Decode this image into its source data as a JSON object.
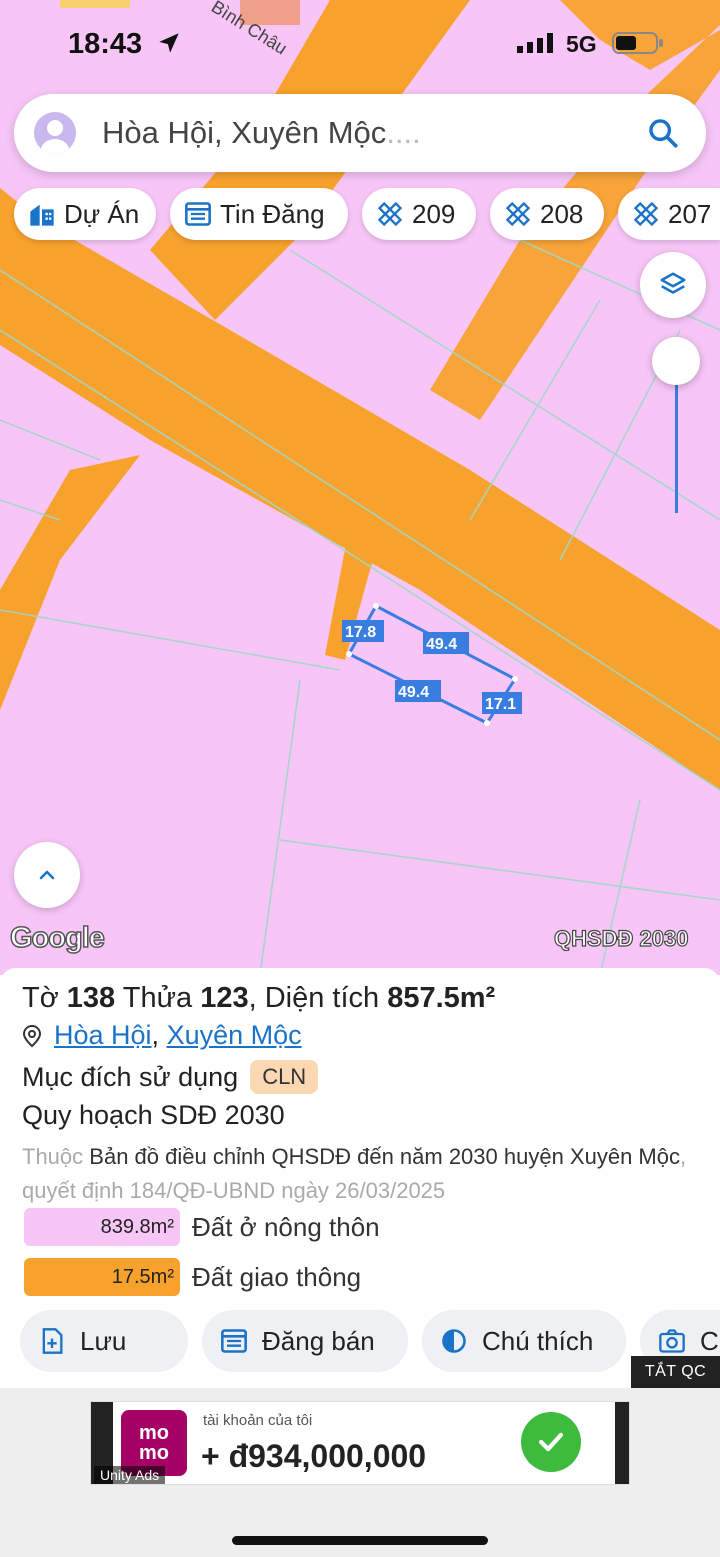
{
  "status_bar": {
    "time": "18:43",
    "network": "5G"
  },
  "map": {
    "street_label": "Bình Châu",
    "layer_label": "QHSDĐ 2030",
    "google_label": "Google",
    "edge_labels": [
      "17.8",
      "49.4",
      "49.4",
      "17.1"
    ]
  },
  "search": {
    "value": "Hòa Hội, Xuyên Mộc",
    "suffix": "...."
  },
  "chips": [
    {
      "label": "Dự Án",
      "icon": "building-icon"
    },
    {
      "label": "Tin Đăng",
      "icon": "listing-icon"
    },
    {
      "label": "209",
      "icon": "ruler-icon"
    },
    {
      "label": "208",
      "icon": "ruler-icon"
    },
    {
      "label": "207",
      "icon": "ruler-icon"
    }
  ],
  "parcel": {
    "sheet_label": "Tờ",
    "sheet": "138",
    "plot_label": "Thửa",
    "plot": "123",
    "area_label": ", Diện tích",
    "area": "857.5m²",
    "ward": "Hòa Hội",
    "district": "Xuyên Mộc",
    "purpose_label": "Mục đích sử dụng",
    "purpose_code": "CLN",
    "plan_title": "Quy hoạch SDĐ 2030",
    "desc_prefix": "Thuộc",
    "desc_main": "Bản đồ điều chỉnh QHSDĐ đến năm 2030 huyện Xuyên Mộc",
    "desc_suffix": ", quyết định 184/QĐ-UBND ngày 26/03/2025"
  },
  "legend": [
    {
      "value": "839.8m²",
      "label": "Đất ở nông thôn",
      "color": "#f7c6f7"
    },
    {
      "value": "17.5m²",
      "label": "Đất giao thông",
      "color": "#f8a22e"
    }
  ],
  "actions": [
    {
      "label": "Lưu",
      "icon": "save-icon"
    },
    {
      "label": "Đăng bán",
      "icon": "post-icon"
    },
    {
      "label": "Chú thích",
      "icon": "legend-icon"
    },
    {
      "label": "C",
      "icon": "camera-icon"
    }
  ],
  "ad": {
    "off_label": "TẮT QC",
    "brand_top": "mo",
    "brand_bottom": "mo",
    "small_text": "tài khoản của tôi",
    "amount": "+ đ934,000,000",
    "network_label": "Unity Ads"
  },
  "colors": {
    "land_pink": "#f7c6f7",
    "road_orange": "#f8a22e",
    "accent_blue": "#1a73c9"
  }
}
